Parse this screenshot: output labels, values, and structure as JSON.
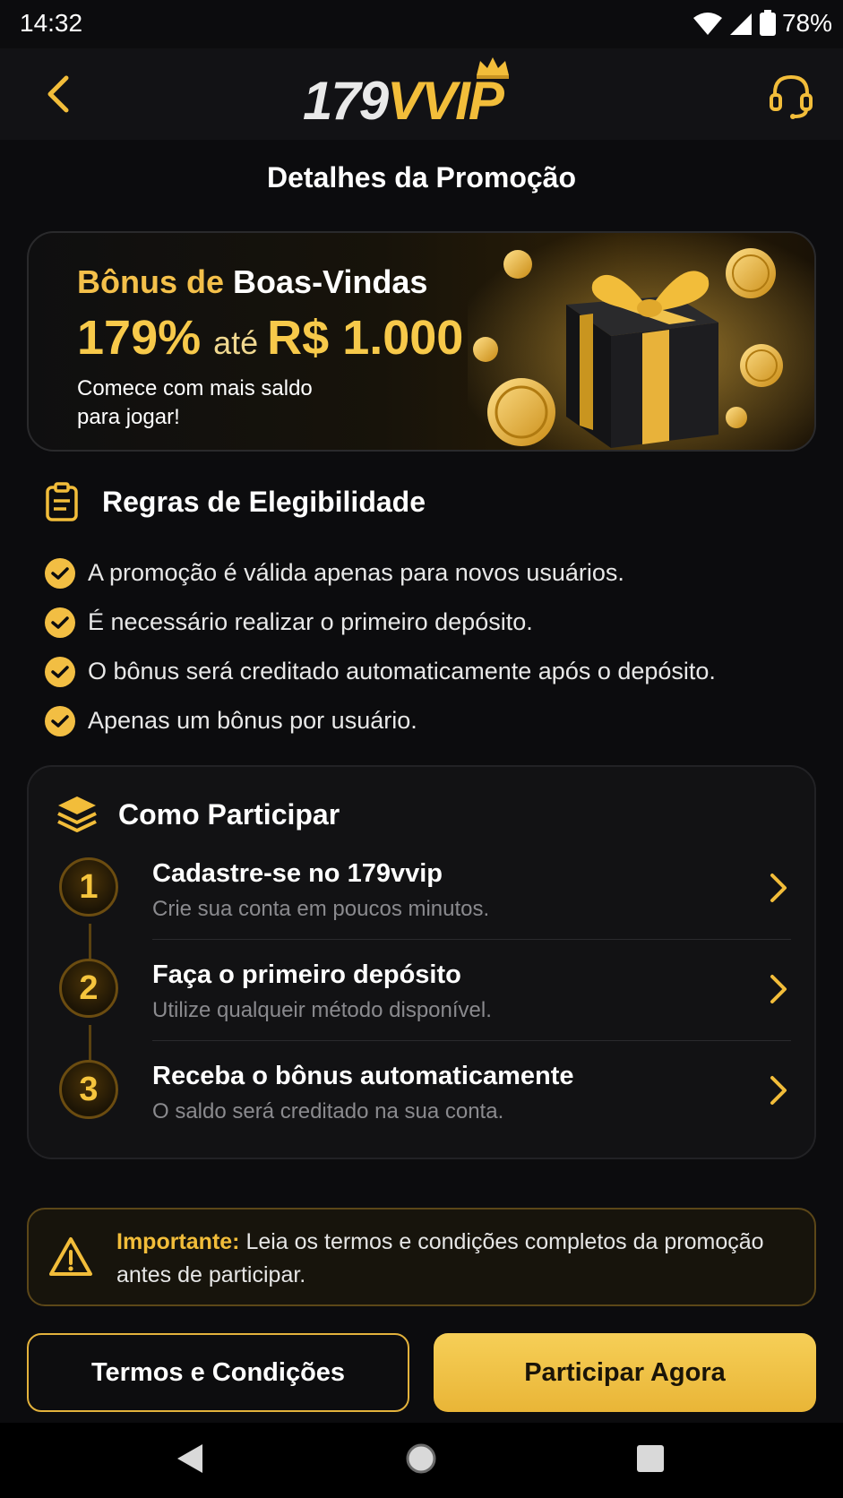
{
  "status_bar": {
    "time": "14:32",
    "battery": "78%"
  },
  "header": {
    "logo_number": "179",
    "logo_brand": "VVIP"
  },
  "page_title": "Detalhes da Promoção",
  "banner": {
    "title_gold": "Bônus de",
    "title_white": "Boas-Vindas",
    "percent": "179%",
    "until": "até",
    "amount": "R$ 1.000",
    "subtitle": "Comece com mais saldo para jogar!"
  },
  "rules": {
    "title": "Regras de Elegibilidade",
    "items": [
      "A promoção é válida apenas para novos usuários.",
      "É necessário realizar o primeiro depósito.",
      "O bônus será creditado automaticamente após o depósito.",
      "Apenas um bônus por usuário."
    ]
  },
  "steps": {
    "title": "Como Participar",
    "items": [
      {
        "num": "1",
        "title": "Cadastre-se no 179vvip",
        "desc": "Crie sua conta em poucos minutos."
      },
      {
        "num": "2",
        "title": "Faça o primeiro depósito",
        "desc": "Utilize qualqueir método disponível."
      },
      {
        "num": "3",
        "title": "Receba o bônus automaticamente",
        "desc": "O saldo será creditado na sua conta."
      }
    ]
  },
  "notice": {
    "label": "Importante:",
    "text": " Leia os termos e condições completos da promoção antes de participar."
  },
  "buttons": {
    "terms": "Termos e Condições",
    "join": "Participar Agora"
  },
  "colors": {
    "accent": "#f2bd3a",
    "background": "#0c0c0e",
    "card": "#121214"
  }
}
